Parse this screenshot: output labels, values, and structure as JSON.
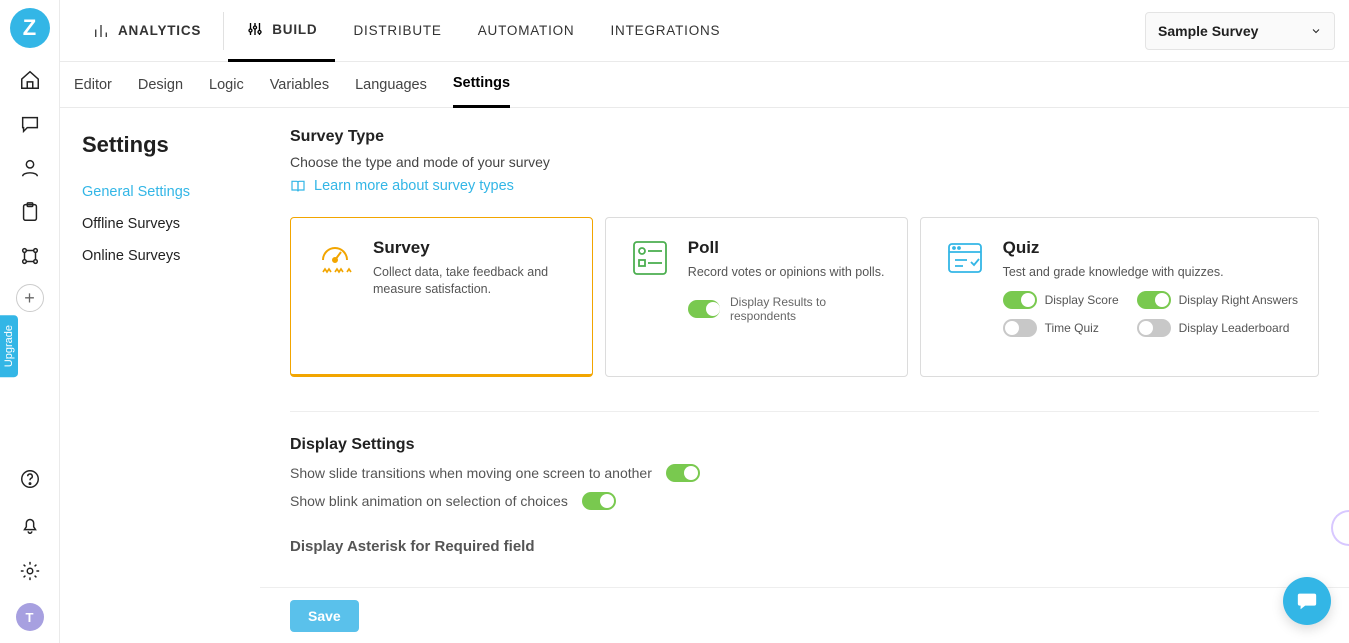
{
  "brand_letter": "Z",
  "upgrade_label": "Upgrade",
  "avatar_letter": "T",
  "topnav": {
    "analytics": "ANALYTICS",
    "build": "BUILD",
    "distribute": "DISTRIBUTE",
    "automation": "AUTOMATION",
    "integrations": "INTEGRATIONS"
  },
  "survey_select_label": "Sample Survey",
  "subtabs": {
    "editor": "Editor",
    "design": "Design",
    "logic": "Logic",
    "variables": "Variables",
    "languages": "Languages",
    "settings": "Settings"
  },
  "sidebar": {
    "heading": "Settings",
    "general": "General Settings",
    "offline": "Offline Surveys",
    "online": "Online Surveys"
  },
  "survey_type": {
    "title": "Survey Type",
    "desc": "Choose the type and mode of your survey",
    "learn": "Learn more about survey types",
    "survey": {
      "title": "Survey",
      "desc": "Collect data, take feedback and measure satisfaction."
    },
    "poll": {
      "title": "Poll",
      "desc": "Record votes or opinions with polls.",
      "display_results": "Display Results to respondents"
    },
    "quiz": {
      "title": "Quiz",
      "desc": "Test and grade knowledge with quizzes.",
      "display_score": "Display Score",
      "display_right": "Display Right Answers",
      "time_quiz": "Time Quiz",
      "display_leaderboard": "Display Leaderboard"
    }
  },
  "display_settings": {
    "title": "Display Settings",
    "transitions": "Show slide transitions when moving one screen to another",
    "blink": "Show blink animation on selection of choices"
  },
  "asterisk_title": "Display Asterisk for Required field",
  "save_label": "Save"
}
